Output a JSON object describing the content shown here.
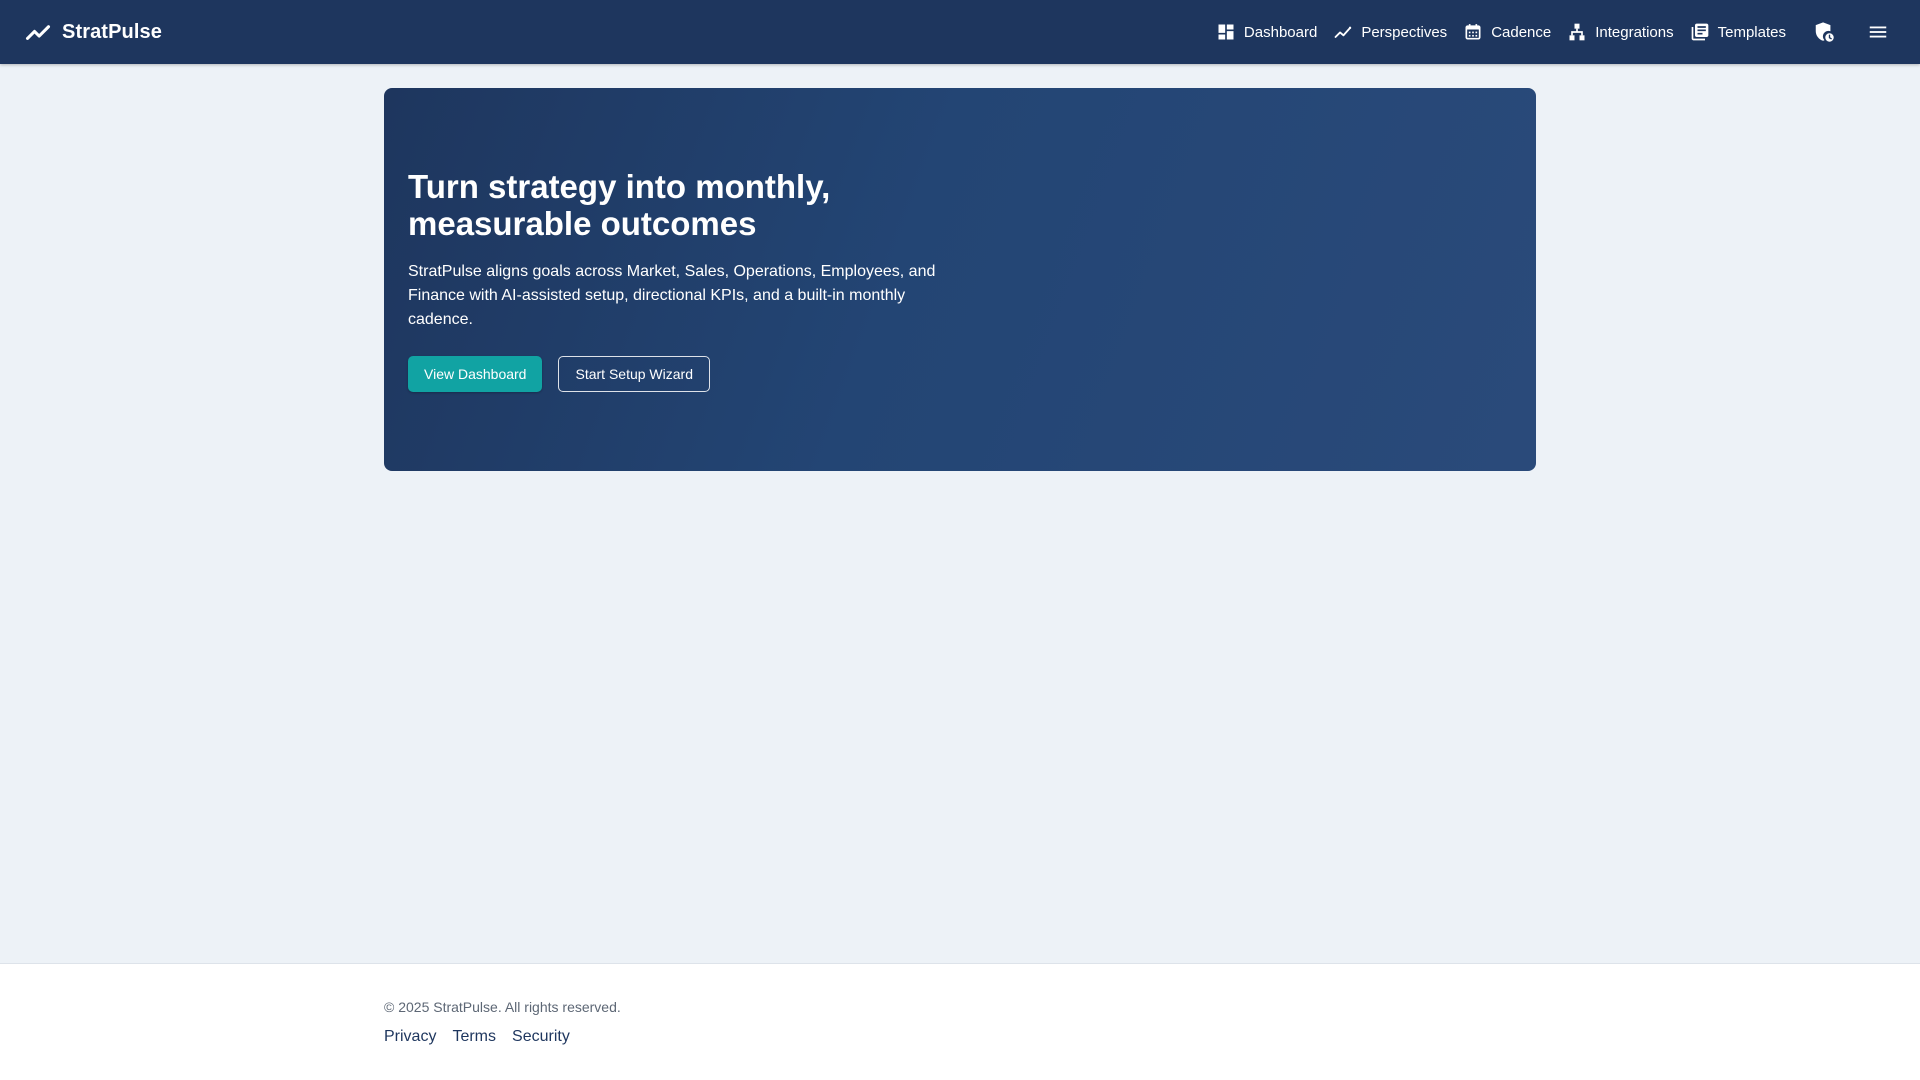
{
  "brand": {
    "name": "StratPulse",
    "icon": "trend-line-icon"
  },
  "nav": {
    "items": [
      {
        "label": "Dashboard",
        "icon": "dashboard-icon"
      },
      {
        "label": "Perspectives",
        "icon": "trend-line-icon"
      },
      {
        "label": "Cadence",
        "icon": "calendar-icon"
      },
      {
        "label": "Integrations",
        "icon": "hierarchy-icon"
      },
      {
        "label": "Templates",
        "icon": "library-books-icon"
      }
    ],
    "security_icon": "shield-clock-icon",
    "menu_icon": "hamburger-menu-icon"
  },
  "hero": {
    "title": "Turn strategy into monthly, measurable outcomes",
    "description": "StratPulse aligns goals across Market, Sales, Operations, Employees, and Finance with AI-assisted setup, directional KPIs, and a built-in monthly cadence.",
    "primary_button": "View Dashboard",
    "secondary_button": "Start Setup Wizard"
  },
  "footer": {
    "copyright": "© 2025 StratPulse. All rights reserved.",
    "links": [
      "Privacy",
      "Terms",
      "Security"
    ]
  },
  "colors": {
    "nav_background": "#1e365e",
    "hero_gradient_start": "#1e365e",
    "hero_gradient_end": "#2a4a7a",
    "accent": "#11a3a3",
    "page_background": "#edf2f7",
    "footer_background": "#ffffff",
    "footer_link": "#1e365e"
  }
}
